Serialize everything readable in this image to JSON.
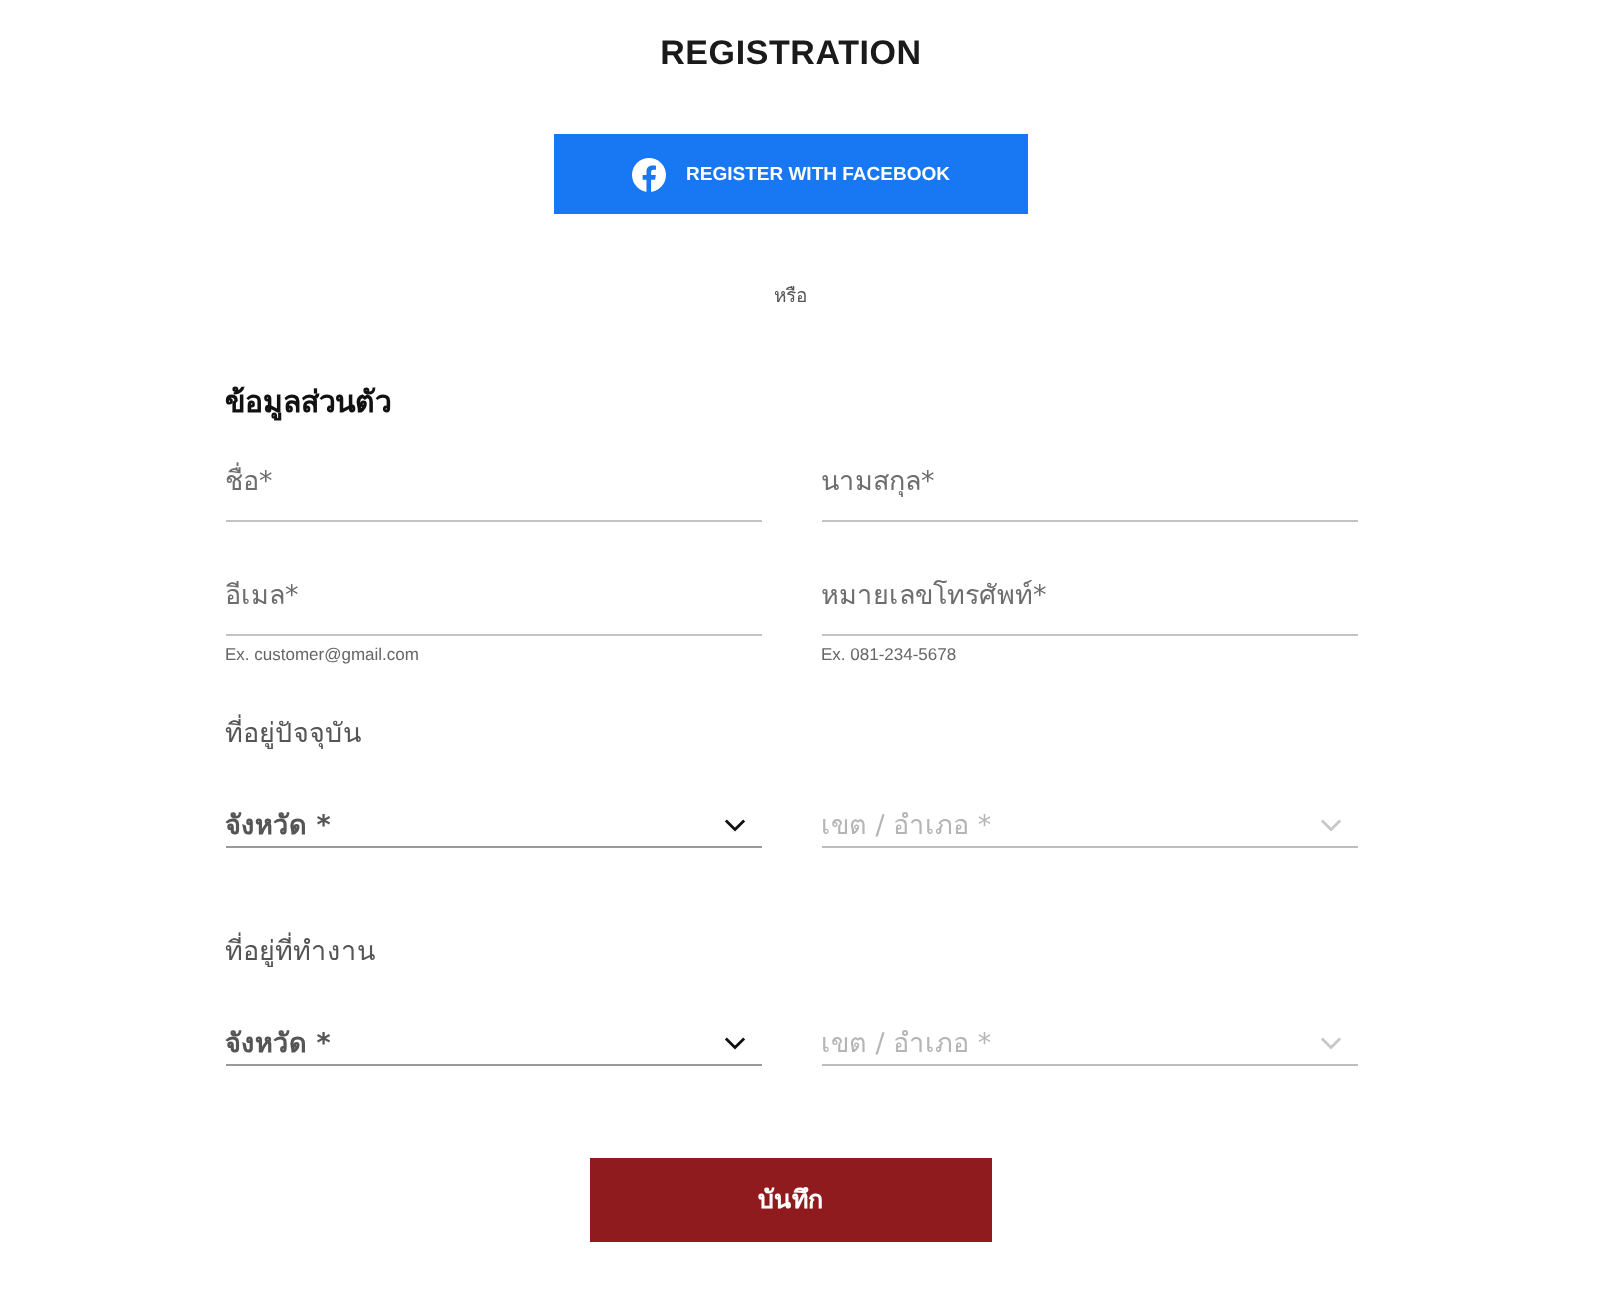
{
  "title": "REGISTRATION",
  "facebook_button": {
    "label": "REGISTER WITH FACEBOOK"
  },
  "divider_text": "หรือ",
  "personal_info": {
    "heading": "ข้อมูลส่วนตัว",
    "fields": [
      {
        "placeholder": "ชื่อ*"
      },
      {
        "placeholder": "นามสกุล*"
      },
      {
        "placeholder": "อีเมล*",
        "hint": "Ex. customer@gmail.com"
      },
      {
        "placeholder": "หมายเลขโทรศัพท์*",
        "hint": "Ex. 081-234-5678"
      }
    ]
  },
  "addresses": [
    {
      "heading": "ที่อยู่ปัจจุบัน",
      "selects": [
        {
          "placeholder": "จังหวัด *",
          "disabled": false
        },
        {
          "placeholder": "เขต / อำเภอ *",
          "disabled": true
        }
      ]
    },
    {
      "heading": "ที่อยู่ที่ทำงาน",
      "selects": [
        {
          "placeholder": "จังหวัด *",
          "disabled": false
        },
        {
          "placeholder": "เขต / อำเภอ *",
          "disabled": true
        }
      ]
    }
  ],
  "save_button": {
    "label": "บันทึก"
  }
}
